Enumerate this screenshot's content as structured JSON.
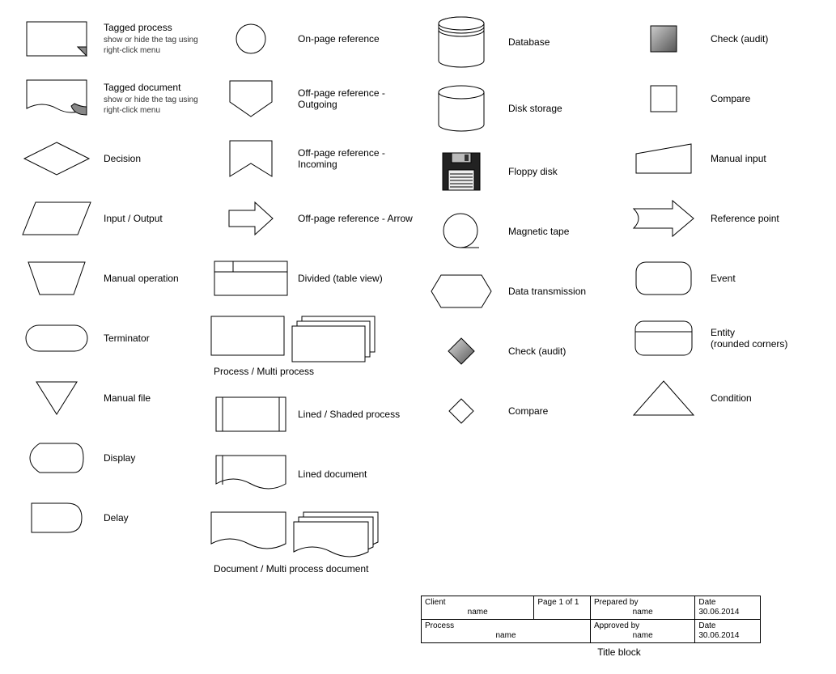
{
  "col1": {
    "tagged_process": {
      "label": "Tagged process",
      "sub": "show or hide the tag using right-click menu"
    },
    "tagged_document": {
      "label": "Tagged document",
      "sub": "show or hide the tag using right-click menu"
    },
    "decision": {
      "label": "Decision"
    },
    "input_output": {
      "label": "Input / Output"
    },
    "manual_operation": {
      "label": "Manual operation"
    },
    "terminator": {
      "label": "Terminator"
    },
    "manual_file": {
      "label": "Manual file"
    },
    "display": {
      "label": "Display"
    },
    "delay": {
      "label": "Delay"
    }
  },
  "col2": {
    "on_page_ref": {
      "label": "On-page reference"
    },
    "off_page_out": {
      "label": "Off-page reference - Outgoing"
    },
    "off_page_in": {
      "label": "Off-page reference - Incoming"
    },
    "off_page_arrow": {
      "label": "Off-page reference - Arrow"
    },
    "divided": {
      "label": "Divided (table view)"
    },
    "process_multi": {
      "label": "Process / Multi process"
    },
    "lined_shaded": {
      "label": "Lined / Shaded process"
    },
    "lined_doc": {
      "label": "Lined document"
    },
    "doc_multi": {
      "label": "Document / Multi process document"
    }
  },
  "col3": {
    "database": {
      "label": "Database"
    },
    "disk": {
      "label": "Disk storage"
    },
    "floppy": {
      "label": "Floppy disk"
    },
    "tape": {
      "label": "Magnetic tape"
    },
    "data_trans": {
      "label": "Data transmission"
    },
    "check": {
      "label": "Check (audit)"
    },
    "compare": {
      "label": "Compare"
    }
  },
  "col4": {
    "check": {
      "label": "Check (audit)"
    },
    "compare": {
      "label": "Compare"
    },
    "manual_input": {
      "label": "Manual input"
    },
    "ref_point": {
      "label": "Reference point"
    },
    "event": {
      "label": "Event"
    },
    "entity": {
      "label": "Entity",
      "sub": "(rounded corners)"
    },
    "condition": {
      "label": "Condition"
    }
  },
  "title_block": {
    "client_lbl": "Client",
    "client_val": "name",
    "page_lbl": "Page",
    "page_val": "1  of  1",
    "prepared_lbl": "Prepared by",
    "prepared_val": "name",
    "date1_lbl": "Date",
    "date1_val": "30.06.2014",
    "process_lbl": "Process",
    "process_val": "name",
    "approved_lbl": "Approved by",
    "approved_val": "name",
    "date2_lbl": "Date",
    "date2_val": "30.06.2014",
    "caption": "Title block"
  }
}
